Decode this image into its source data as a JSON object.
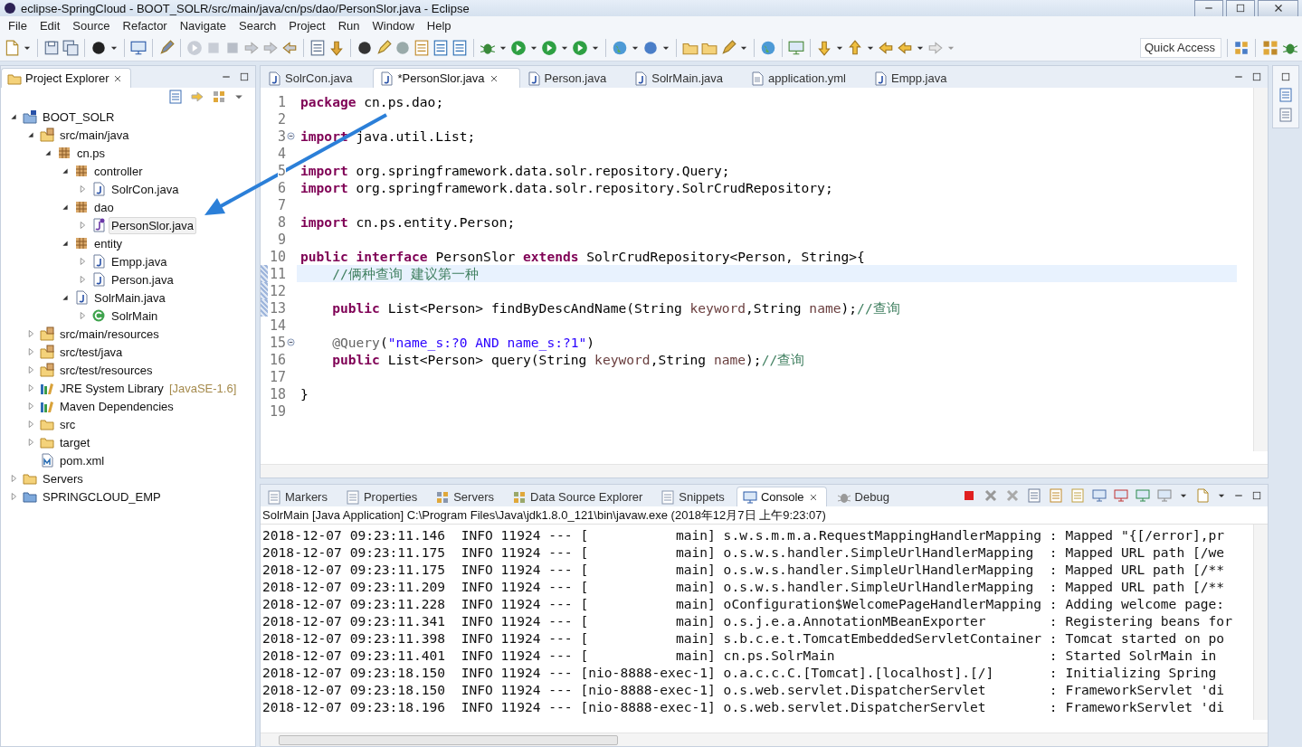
{
  "window": {
    "title": "eclipse-SpringCloud - BOOT_SOLR/src/main/java/cn/ps/dao/PersonSlor.java - Eclipse"
  },
  "menu": [
    "File",
    "Edit",
    "Source",
    "Refactor",
    "Navigate",
    "Search",
    "Project",
    "Run",
    "Window",
    "Help"
  ],
  "toolbar": {
    "quick_access": {
      "placeholder": "Quick Access"
    }
  },
  "explorer": {
    "title": "Project Explorer",
    "tree": [
      {
        "label": "BOOT_SOLR",
        "kind": "project",
        "expanded": true,
        "selected": false,
        "children": [
          {
            "label": "src/main/java",
            "kind": "source-folder",
            "expanded": true,
            "selected": false,
            "children": [
              {
                "label": "cn.ps",
                "kind": "package",
                "expanded": true,
                "selected": false,
                "children": [
                  {
                    "label": "controller",
                    "kind": "package",
                    "expanded": true,
                    "selected": false,
                    "children": [
                      {
                        "label": "SolrCon.java",
                        "kind": "java-file",
                        "expanded": false,
                        "selected": false
                      }
                    ]
                  },
                  {
                    "label": "dao",
                    "kind": "package",
                    "expanded": true,
                    "selected": false,
                    "children": [
                      {
                        "label": "PersonSlor.java",
                        "kind": "interface-file",
                        "expanded": false,
                        "selected": true
                      }
                    ]
                  },
                  {
                    "label": "entity",
                    "kind": "package",
                    "expanded": true,
                    "selected": false,
                    "children": [
                      {
                        "label": "Empp.java",
                        "kind": "java-file",
                        "expanded": false,
                        "selected": false
                      },
                      {
                        "label": "Person.java",
                        "kind": "java-file",
                        "expanded": false,
                        "selected": false
                      }
                    ]
                  },
                  {
                    "label": "SolrMain.java",
                    "kind": "java-file",
                    "expanded": true,
                    "selected": false,
                    "children": [
                      {
                        "label": "SolrMain",
                        "kind": "class",
                        "expanded": false,
                        "selected": false
                      }
                    ]
                  }
                ]
              }
            ]
          },
          {
            "label": "src/main/resources",
            "kind": "source-folder",
            "expanded": false,
            "selected": false
          },
          {
            "label": "src/test/java",
            "kind": "source-folder",
            "expanded": false,
            "selected": false
          },
          {
            "label": "src/test/resources",
            "kind": "source-folder",
            "expanded": false,
            "selected": false
          },
          {
            "label": "JRE System Library",
            "suffix": "[JavaSE-1.6]",
            "kind": "library",
            "expanded": false,
            "selected": false
          },
          {
            "label": "Maven Dependencies",
            "kind": "library",
            "expanded": false,
            "selected": false
          },
          {
            "label": "src",
            "kind": "folder",
            "expanded": false,
            "selected": false
          },
          {
            "label": "target",
            "kind": "folder",
            "expanded": false,
            "selected": false
          },
          {
            "label": "pom.xml",
            "kind": "xml-file",
            "selected": false
          }
        ]
      },
      {
        "label": "Servers",
        "kind": "folder",
        "expanded": false,
        "selected": false
      },
      {
        "label": "SPRINGCLOUD_EMP",
        "kind": "closed-project",
        "expanded": false,
        "selected": false
      }
    ]
  },
  "editor": {
    "tabs": [
      {
        "label": "SolrCon.java",
        "kind": "java",
        "selected": false
      },
      {
        "label": "*PersonSlor.java",
        "kind": "java",
        "selected": true
      },
      {
        "label": "Person.java",
        "kind": "java",
        "selected": false
      },
      {
        "label": "SolrMain.java",
        "kind": "java",
        "selected": false
      },
      {
        "label": "application.yml",
        "kind": "text",
        "selected": false
      },
      {
        "label": "Empp.java",
        "kind": "java",
        "selected": false
      }
    ],
    "lines": [
      {
        "number": "1",
        "current": false,
        "changed": false,
        "fold": false,
        "tokens": [
          {
            "kind": "keyword",
            "text": "package"
          },
          {
            "kind": "plain",
            "text": " cn.ps.dao;"
          }
        ]
      },
      {
        "number": "2",
        "current": false,
        "changed": false,
        "fold": false
      },
      {
        "number": "3",
        "current": false,
        "changed": false,
        "fold": true,
        "tokens": [
          {
            "kind": "keyword",
            "text": "import"
          },
          {
            "kind": "plain",
            "text": " java.util.List;"
          }
        ]
      },
      {
        "number": "4",
        "current": false,
        "changed": false,
        "fold": false
      },
      {
        "number": "5",
        "current": false,
        "changed": false,
        "fold": false,
        "tokens": [
          {
            "kind": "keyword",
            "text": "import"
          },
          {
            "kind": "plain",
            "text": " org.springframework.data.solr.repository.Query;"
          }
        ]
      },
      {
        "number": "6",
        "current": false,
        "changed": false,
        "fold": false,
        "tokens": [
          {
            "kind": "keyword",
            "text": "import"
          },
          {
            "kind": "plain",
            "text": " org.springframework.data.solr.repository.SolrCrudRepository;"
          }
        ]
      },
      {
        "number": "7",
        "current": false,
        "changed": false,
        "fold": false
      },
      {
        "number": "8",
        "current": false,
        "changed": false,
        "fold": false,
        "tokens": [
          {
            "kind": "keyword",
            "text": "import"
          },
          {
            "kind": "plain",
            "text": " cn.ps.entity.Person;"
          }
        ]
      },
      {
        "number": "9",
        "current": false,
        "changed": false,
        "fold": false
      },
      {
        "number": "10",
        "current": false,
        "changed": false,
        "fold": false,
        "tokens": [
          {
            "kind": "keyword",
            "text": "public interface"
          },
          {
            "kind": "plain",
            "text": " PersonSlor "
          },
          {
            "kind": "keyword",
            "text": "extends"
          },
          {
            "kind": "plain",
            "text": " SolrCrudRepository<Person, String>{"
          }
        ]
      },
      {
        "number": "11",
        "current": true,
        "changed": true,
        "fold": false,
        "tokens": [
          {
            "kind": "comment",
            "text": "    //俩种查询 建议第一种"
          }
        ]
      },
      {
        "number": "12",
        "current": false,
        "changed": true,
        "fold": false
      },
      {
        "number": "13",
        "current": false,
        "changed": true,
        "fold": false,
        "tokens": [
          {
            "kind": "keyword",
            "text": "    public"
          },
          {
            "kind": "plain",
            "text": " List<Person> findByDescAndName(String "
          },
          {
            "kind": "param",
            "text": "keyword"
          },
          {
            "kind": "plain",
            "text": ",String "
          },
          {
            "kind": "param",
            "text": "name"
          },
          {
            "kind": "plain",
            "text": ");"
          },
          {
            "kind": "comment",
            "text": "//查询"
          }
        ]
      },
      {
        "number": "14",
        "current": false,
        "changed": false,
        "fold": false
      },
      {
        "number": "15",
        "current": false,
        "changed": false,
        "fold": true,
        "tokens": [
          {
            "kind": "annotation",
            "text": "    @Query"
          },
          {
            "kind": "plain",
            "text": "("
          },
          {
            "kind": "string",
            "text": "\"name_s:?0 AND name_s:?1\""
          },
          {
            "kind": "plain",
            "text": ")"
          }
        ]
      },
      {
        "number": "16",
        "current": false,
        "changed": false,
        "fold": false,
        "tokens": [
          {
            "kind": "keyword",
            "text": "    public"
          },
          {
            "kind": "plain",
            "text": " List<Person> query(String "
          },
          {
            "kind": "param",
            "text": "keyword"
          },
          {
            "kind": "plain",
            "text": ",String "
          },
          {
            "kind": "param",
            "text": "name"
          },
          {
            "kind": "plain",
            "text": ");"
          },
          {
            "kind": "comment",
            "text": "//查询"
          }
        ]
      },
      {
        "number": "17",
        "current": false,
        "changed": false,
        "fold": false
      },
      {
        "number": "18",
        "current": false,
        "changed": false,
        "fold": false,
        "tokens": [
          {
            "kind": "plain",
            "text": "}"
          }
        ]
      },
      {
        "number": "19",
        "current": false,
        "changed": false,
        "fold": false
      }
    ]
  },
  "console": {
    "tabs": [
      {
        "label": "Markers",
        "selected": false
      },
      {
        "label": "Properties",
        "selected": false
      },
      {
        "label": "Servers",
        "selected": false
      },
      {
        "label": "Data Source Explorer",
        "selected": false
      },
      {
        "label": "Snippets",
        "selected": false
      },
      {
        "label": "Console",
        "selected": true
      },
      {
        "label": "Debug",
        "selected": false
      }
    ],
    "process": "SolrMain [Java Application] C:\\Program Files\\Java\\jdk1.8.0_121\\bin\\javaw.exe (2018年12月7日 上午9:23:07)",
    "lines": [
      "2018-12-07 09:23:11.146  INFO 11924 --- [           main] s.w.s.m.m.a.RequestMappingHandlerMapping : Mapped \"{[/error],pr",
      "2018-12-07 09:23:11.175  INFO 11924 --- [           main] o.s.w.s.handler.SimpleUrlHandlerMapping  : Mapped URL path [/we",
      "2018-12-07 09:23:11.175  INFO 11924 --- [           main] o.s.w.s.handler.SimpleUrlHandlerMapping  : Mapped URL path [/**",
      "2018-12-07 09:23:11.209  INFO 11924 --- [           main] o.s.w.s.handler.SimpleUrlHandlerMapping  : Mapped URL path [/**",
      "2018-12-07 09:23:11.228  INFO 11924 --- [           main] oConfiguration$WelcomePageHandlerMapping : Adding welcome page:",
      "2018-12-07 09:23:11.341  INFO 11924 --- [           main] o.s.j.e.a.AnnotationMBeanExporter        : Registering beans for",
      "2018-12-07 09:23:11.398  INFO 11924 --- [           main] s.b.c.e.t.TomcatEmbeddedServletContainer : Tomcat started on po",
      "2018-12-07 09:23:11.401  INFO 11924 --- [           main] cn.ps.SolrMain                           : Started SolrMain in",
      "2018-12-07 09:23:18.150  INFO 11924 --- [nio-8888-exec-1] o.a.c.c.C.[Tomcat].[localhost].[/]       : Initializing Spring",
      "2018-12-07 09:23:18.150  INFO 11924 --- [nio-8888-exec-1] o.s.web.servlet.DispatcherServlet        : FrameworkServlet 'di",
      "2018-12-07 09:23:18.196  INFO 11924 --- [nio-8888-exec-1] o.s.web.servlet.DispatcherServlet        : FrameworkServlet 'di"
    ]
  }
}
